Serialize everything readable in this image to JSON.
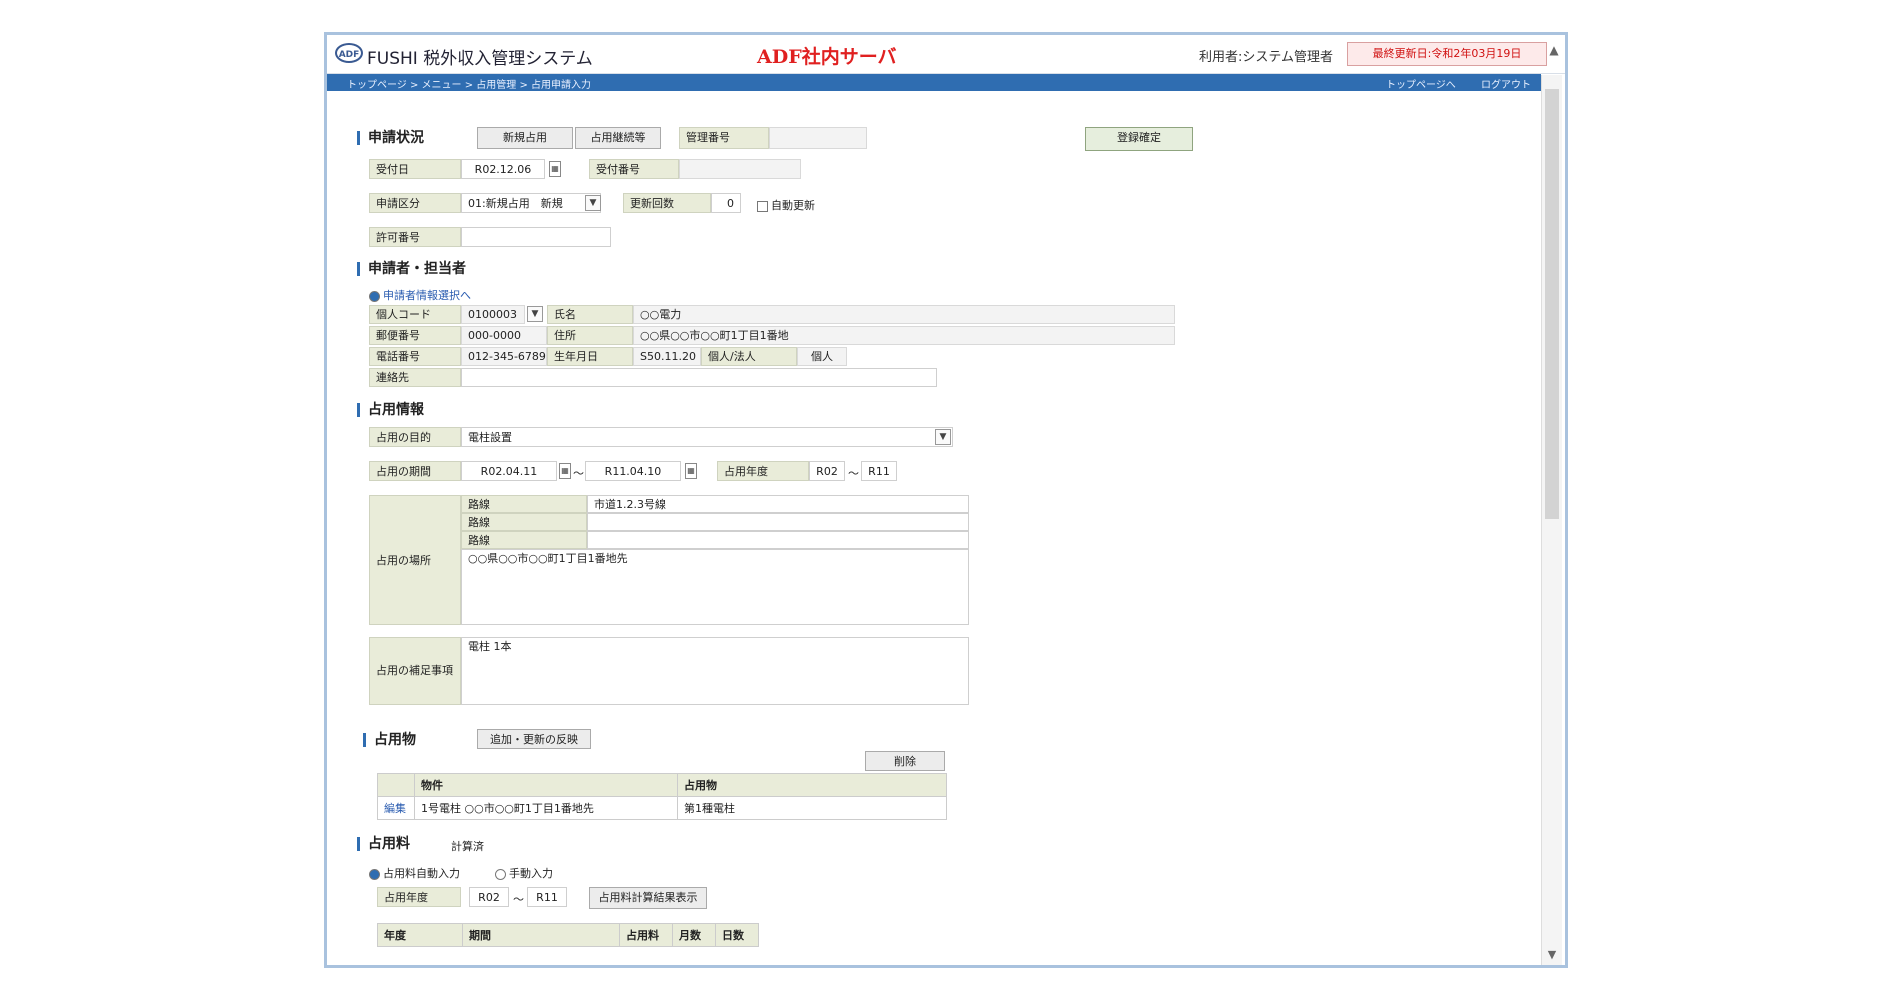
{
  "header": {
    "logo": "ADF",
    "title": "FUSHI 税外収入管理システム",
    "server": "ADF社内サーバ",
    "user": "利用者:システム管理者",
    "notice": "最終更新日:令和2年03月19日"
  },
  "nav": {
    "breadcrumb": "トップページ > メニュー > 占用管理 > 占用申請入力",
    "links": [
      "トップページへ",
      "ログアウト"
    ]
  },
  "sections": {
    "application": "申請状況",
    "applicant": "申請者・担当者",
    "occupancy": "占用情報",
    "objects": "占用物",
    "fee": "占用料"
  },
  "status": {
    "buttons": [
      "新規占用",
      "占用継続等"
    ],
    "mgmt_no_label": "管理番号",
    "mgmt_no_value": "",
    "register_button": "登録確定"
  },
  "receipt": {
    "date_label": "受付日",
    "date_value": "R02.12.06",
    "no_label": "受付番号",
    "no_value": "",
    "category_label": "申請区分",
    "category_value": "01:新規占用　新規",
    "count_label": "更新回数",
    "count_value": "0",
    "auto_label": "自動更新",
    "permit_label": "許可番号",
    "permit_value": ""
  },
  "applicant": {
    "link": "申請者情報選択へ",
    "code_label": "個人コード",
    "code_value": "0100003",
    "name_label": "氏名",
    "name_value": "○○電力",
    "zip_label": "郵便番号",
    "zip_value": "000-0000",
    "address_label": "住所",
    "address_value": "○○県○○市○○町1丁目1番地",
    "tel_label": "電話番号",
    "tel_value": "012-345-6789",
    "birth_label": "生年月日",
    "birth_value": "S50.11.20",
    "type_label": "個人/法人",
    "type_value": "個人",
    "contact_label": "連絡先",
    "contact_value": ""
  },
  "occupancy": {
    "purpose_label": "占用の目的",
    "purpose_value": "電柱設置",
    "period_label": "占用の期間",
    "period_from": "R02.04.11",
    "period_to": "R11.04.10",
    "year_label": "占用年度",
    "year_from": "R02",
    "year_to": "R11",
    "place_label": "占用の場所",
    "place_rows": [
      {
        "label": "路線",
        "value": "市道1.2.3号線"
      },
      {
        "label": "路線",
        "value": ""
      },
      {
        "label": "路線",
        "value": ""
      }
    ],
    "place_address": "○○県○○市○○町1丁目1番地先",
    "note_label": "占用の補足事項",
    "note_value": "電柱 1本"
  },
  "objects": {
    "add_button": "追加・更新の反映",
    "delete_button": "削除",
    "headers": [
      "",
      "物件",
      "占用物"
    ],
    "rows": [
      {
        "action": "編集",
        "item": "1号電柱 ○○市○○町1丁目1番地先",
        "object": "第1種電柱"
      }
    ]
  },
  "fee": {
    "status": "計算済",
    "mode_auto": "占用料自動入力",
    "mode_manual": "手動入力",
    "year_label": "占用年度",
    "year_from": "R02",
    "year_to": "R11",
    "calc_button": "占用料計算結果表示",
    "headers": [
      "年度",
      "期間",
      "占用料",
      "月数",
      "日数"
    ]
  }
}
